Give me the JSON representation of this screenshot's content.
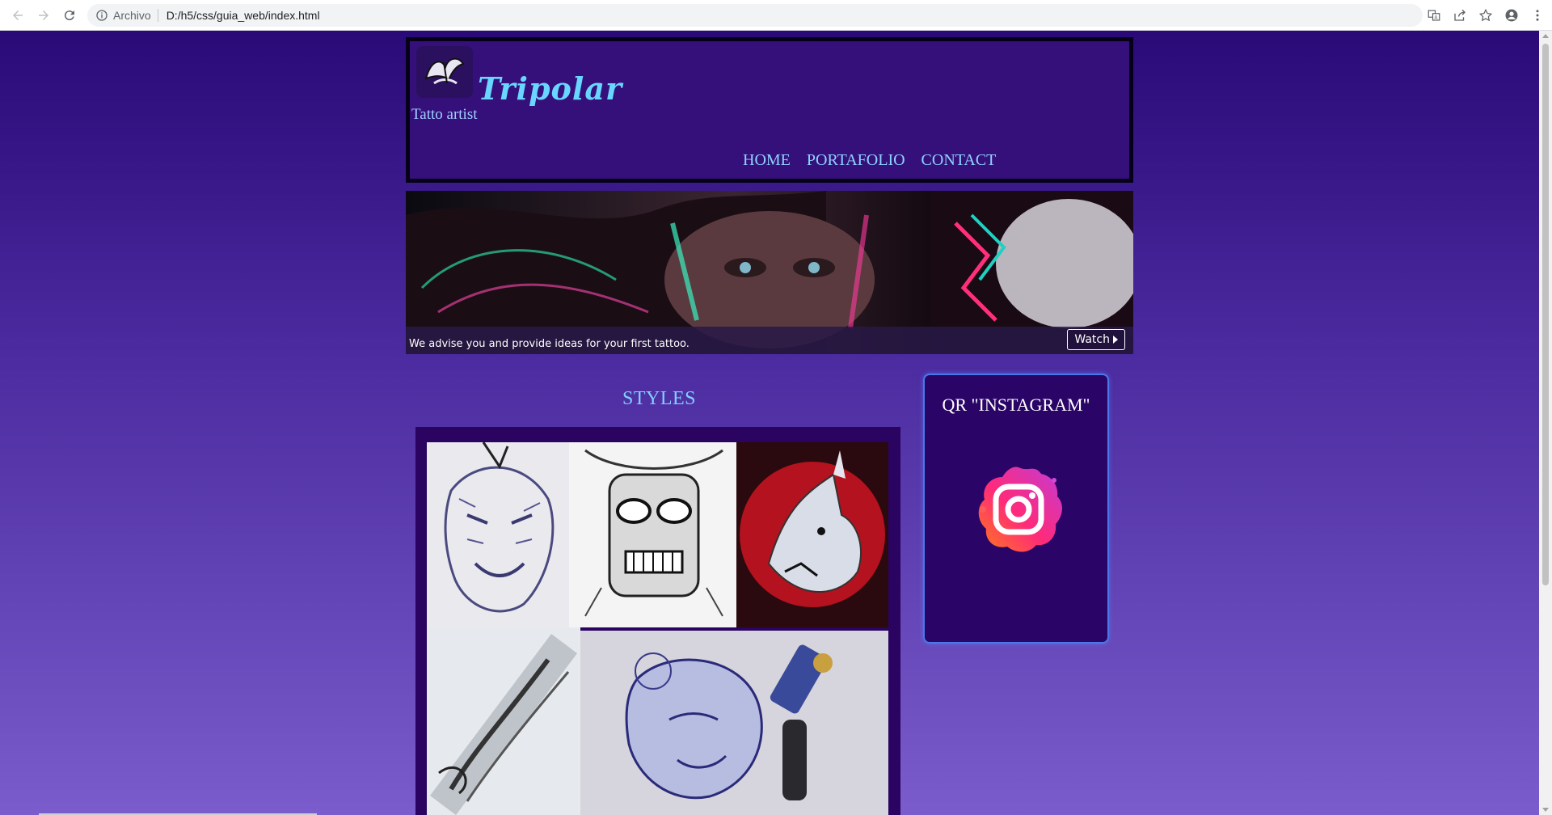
{
  "browser": {
    "security_label": "Archivo",
    "url": "D:/h5/css/guia_web/index.html"
  },
  "header": {
    "title": "Tripolar",
    "subtitle": "Tatto artist",
    "nav": [
      "HOME",
      "PORTAFOLIO",
      "CONTACT"
    ]
  },
  "hero": {
    "caption": "We advise you and provide ideas for your first tattoo.",
    "button_label": "Watch"
  },
  "styles": {
    "title": "STYLES",
    "tiles": [
      "tiger-sketch",
      "tiki-mask-sketch",
      "red-wolf-drawing",
      "lettering-sketch",
      "face-drawing-with-tattoo-machine"
    ]
  },
  "qr_card": {
    "title": "QR \"INSTAGRAM\"",
    "icon": "instagram-icon"
  },
  "colors": {
    "page_top": "#2a0a77",
    "page_bottom": "#7a5ccc",
    "title_accent": "#69d6ff",
    "nav_link": "#8ed3ff",
    "card_border": "#4a78e8"
  }
}
